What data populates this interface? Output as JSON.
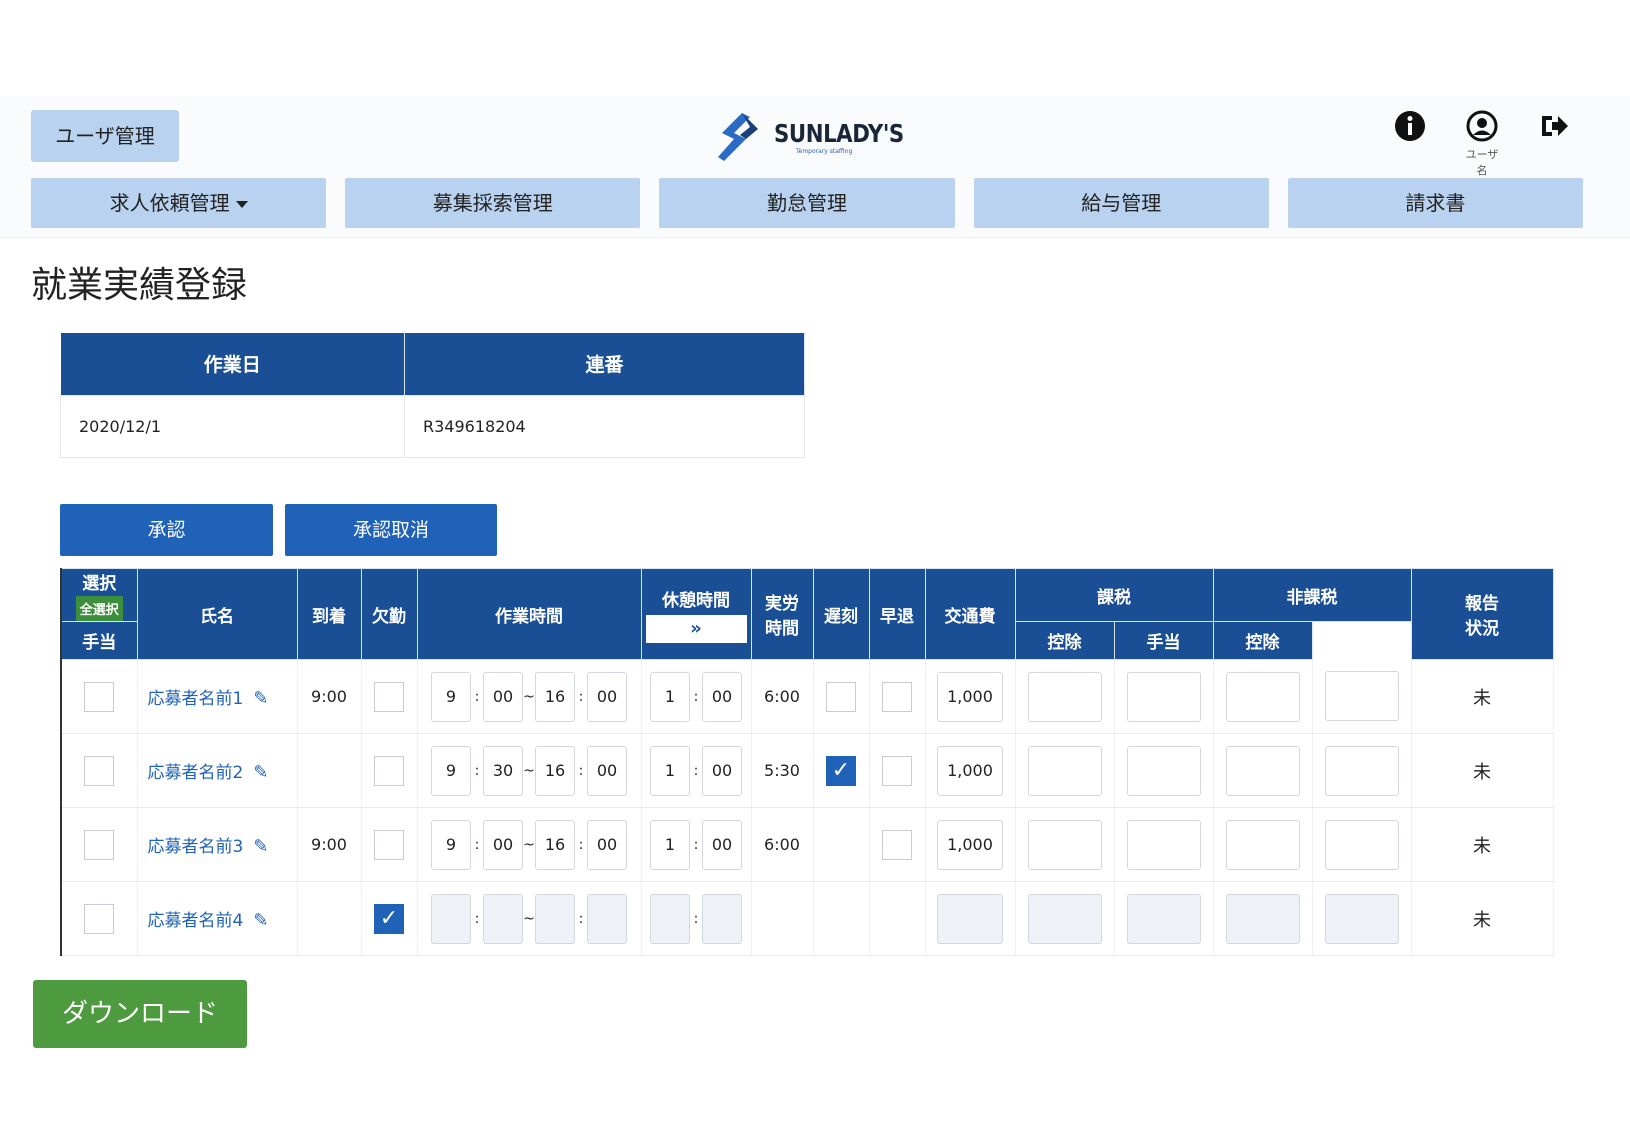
{
  "header": {
    "user_mgmt": "ユーザ管理",
    "logo_name": "SUNLADY'S",
    "logo_sub": "Temporary staffing",
    "user_caption": "ユーザ名"
  },
  "nav": [
    {
      "label": "求人依頼管理"
    },
    {
      "label": "募集採索管理"
    },
    {
      "label": "勤怠管理"
    },
    {
      "label": "給与管理"
    },
    {
      "label": "請求書"
    }
  ],
  "page_title": "就業実績登録",
  "info": {
    "col_date": "作業日",
    "col_serial": "連番",
    "date": "2020/12/1",
    "serial": "R349618204"
  },
  "buttons": {
    "approve": "承認",
    "unapprove": "承認取消",
    "download": "ダウンロード"
  },
  "grid": {
    "h_select": "選択",
    "h_select_all": "全選択",
    "h_name": "氏名",
    "h_arrival": "到着",
    "h_absent": "欠勤",
    "h_work_time": "作業時間",
    "h_break_time": "休憩時間",
    "h_break_btn": "»",
    "h_actual_1": "実労",
    "h_actual_2": "時間",
    "h_late": "遅刻",
    "h_early": "早退",
    "h_transport": "交通費",
    "h_taxable": "課税",
    "h_nontaxable": "非課税",
    "h_allowance": "手当",
    "h_deduction": "控除",
    "h_report_1": "報告",
    "h_report_2": "状況",
    "time_sep": ":",
    "range_sep": "~",
    "rows": [
      {
        "name": "応募者名前1",
        "arrival": "9:00",
        "absent": false,
        "sh": "9",
        "sm": "00",
        "eh": "16",
        "em": "00",
        "bh": "1",
        "bm": "00",
        "actual": "6:00",
        "late": false,
        "fee": "1,000",
        "status": "未"
      },
      {
        "name": "応募者名前2",
        "arrival": "",
        "absent": false,
        "sh": "9",
        "sm": "30",
        "eh": "16",
        "em": "00",
        "bh": "1",
        "bm": "00",
        "actual": "5:30",
        "late": true,
        "fee": "1,000",
        "status": "未"
      },
      {
        "name": "応募者名前3",
        "arrival": "9:00",
        "absent": false,
        "sh": "9",
        "sm": "00",
        "eh": "16",
        "em": "00",
        "bh": "1",
        "bm": "00",
        "actual": "6:00",
        "late": false,
        "fee": "1,000",
        "status": "未"
      },
      {
        "name": "応募者名前4",
        "arrival": "",
        "absent": true,
        "sh": "",
        "sm": "",
        "eh": "",
        "em": "",
        "bh": "",
        "bm": "",
        "actual": "",
        "late": false,
        "fee": "",
        "status": "未"
      }
    ]
  }
}
